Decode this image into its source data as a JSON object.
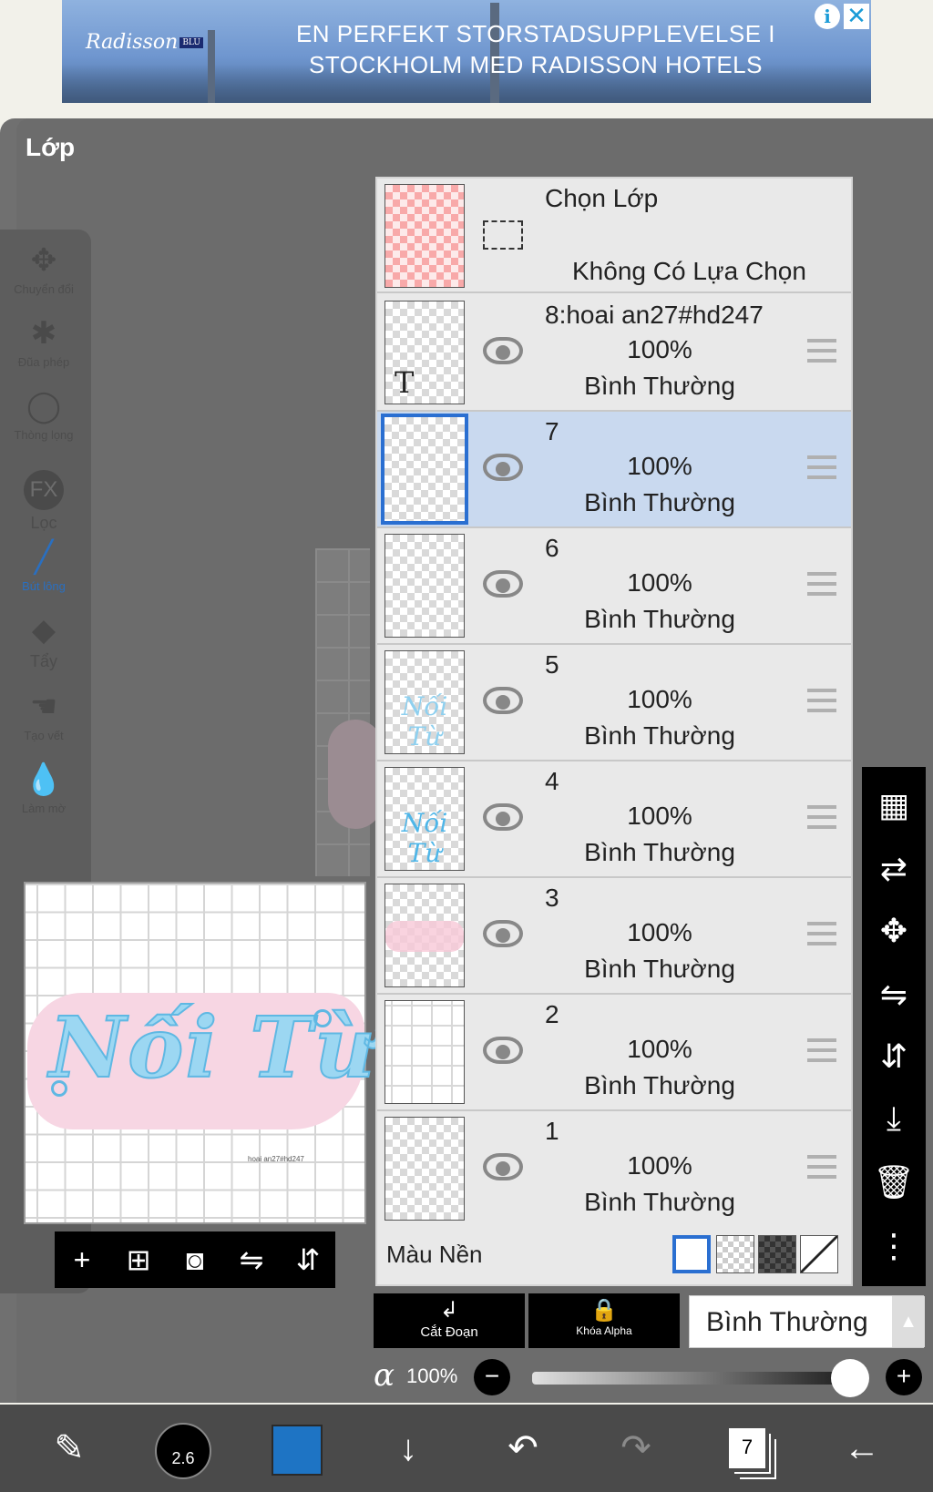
{
  "ad": {
    "logo": "Radisson",
    "logo_tag": "BLU",
    "line1": "EN PERFEKT STORSTADSUPPLEVELSE I",
    "line2": "STOCKHOLM MED RADISSON HOTELS",
    "info_icon": "info-icon",
    "close_icon": "close-icon"
  },
  "panel_title": "Lớp",
  "tools": [
    {
      "icon": "move-icon",
      "label": "Chuyển đổi"
    },
    {
      "icon": "magic-wand-icon",
      "label": "Đũa phép"
    },
    {
      "icon": "lasso-icon",
      "label": "Thòng lọng"
    },
    {
      "icon": "fx-icon",
      "label": "Lọc"
    },
    {
      "icon": "brush-icon",
      "label": "Bút lông",
      "active": true
    },
    {
      "icon": "eraser-icon",
      "label": "Tẩy"
    },
    {
      "icon": "smudge-icon",
      "label": "Tạo vết"
    },
    {
      "icon": "blur-icon",
      "label": "Làm mờ"
    }
  ],
  "navigator": {
    "artwork_text": "Nối Từ",
    "small_text": "hoai an27#hd247",
    "buttons": [
      "add-icon",
      "add-layer-icon",
      "camera-icon",
      "flip-h-icon",
      "flip-v-icon"
    ]
  },
  "selection_layer": {
    "title": "Chọn Lớp",
    "status": "Không Có Lựa Chọn"
  },
  "layers": [
    {
      "name": "8:hoai an27#hd247",
      "opacity": "100%",
      "mode": "Bình Thường",
      "thumb": "text"
    },
    {
      "name": "7",
      "opacity": "100%",
      "mode": "Bình Thường",
      "selected": true
    },
    {
      "name": "6",
      "opacity": "100%",
      "mode": "Bình Thường"
    },
    {
      "name": "5",
      "opacity": "100%",
      "mode": "Bình Thường",
      "thumb": "script"
    },
    {
      "name": "4",
      "opacity": "100%",
      "mode": "Bình Thường",
      "thumb": "script"
    },
    {
      "name": "3",
      "opacity": "100%",
      "mode": "Bình Thường",
      "thumb": "pink"
    },
    {
      "name": "2",
      "opacity": "100%",
      "mode": "Bình Thường",
      "thumb": "grid"
    },
    {
      "name": "1",
      "opacity": "100%",
      "mode": "Bình Thường"
    }
  ],
  "layer_thumb_text": "T",
  "thumb_script_text": "Nối Từ",
  "background_color": {
    "label": "Màu Nền",
    "options": [
      "white",
      "transparent",
      "dark-checker",
      "none"
    ],
    "selected": "white"
  },
  "right_tools": [
    "checker-icon",
    "swap-layer-icon",
    "move-icon",
    "flip-h-icon",
    "flip-v-icon",
    "merge-down-icon",
    "trash-icon",
    "more-icon"
  ],
  "buttons": {
    "clip_label": "Cắt Đoạn",
    "alpha_lock_label": "Khóa Alpha",
    "blend_mode": "Bình Thường"
  },
  "opacity": {
    "symbol": "α",
    "value": "100%",
    "fraction": 1.0
  },
  "bottom_bar": {
    "brush_size": "2.6",
    "color": "#1e74c4",
    "layer_count": "7"
  }
}
